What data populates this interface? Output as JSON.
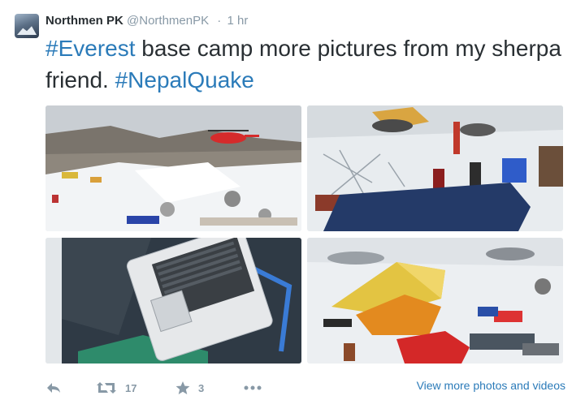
{
  "tweet": {
    "author_name": "Northmen PK",
    "author_handle": "@NorthmenPK",
    "separator": "·",
    "time": "1 hr",
    "text_part1": "#Everest",
    "text_part2": " base camp more pictures from my sherpa friend. ",
    "text_part3": "#NepalQuake"
  },
  "actions": {
    "retweet_count": "17",
    "favorite_count": "3",
    "view_more_label": "View more photos and videos"
  },
  "colors": {
    "link": "#2b7bb9",
    "muted": "#8899a6",
    "text": "#292f33"
  },
  "icons": [
    "reply-icon",
    "retweet-icon",
    "favorite-star-icon",
    "more-dots-icon"
  ]
}
